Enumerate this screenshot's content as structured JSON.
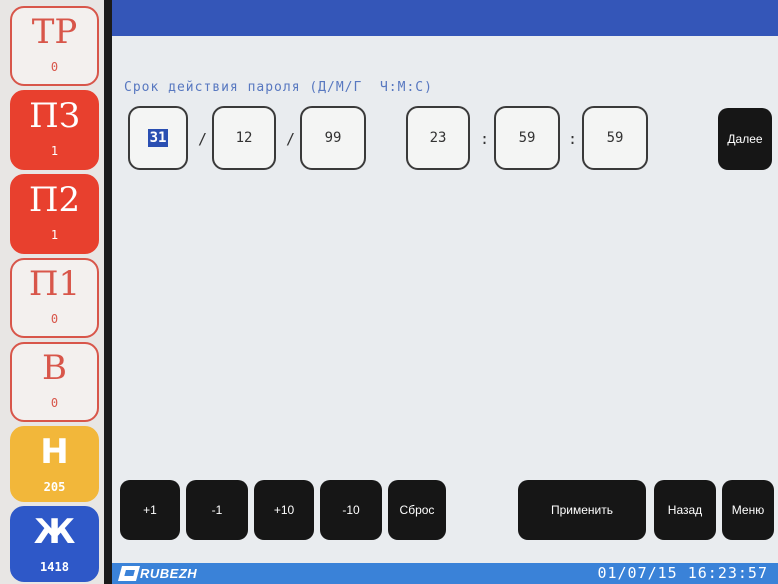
{
  "sidebar": {
    "indicators": [
      {
        "label": "ТР",
        "count": "0",
        "state": "off"
      },
      {
        "label": "ПЗ",
        "count": "1",
        "state": "red"
      },
      {
        "label": "П2",
        "count": "1",
        "state": "red"
      },
      {
        "label": "П1",
        "count": "0",
        "state": "off"
      },
      {
        "label": "В",
        "count": "0",
        "state": "off"
      },
      {
        "label": "Н",
        "count": "205",
        "state": "yellow"
      },
      {
        "label": "Ж",
        "count": "1418",
        "state": "blue"
      }
    ]
  },
  "form": {
    "title": "Срок действия пароля (Д/М/Г  Ч:М:С)",
    "day": "31",
    "month": "12",
    "year": "99",
    "hour": "23",
    "minute": "59",
    "second": "59",
    "date_sep": "/",
    "time_sep": ":"
  },
  "buttons": {
    "next": "Далее",
    "plus1": "+1",
    "minus1": "-1",
    "plus10": "+10",
    "minus10": "-10",
    "reset": "Сброс",
    "apply": "Применить",
    "back": "Назад",
    "menu": "Меню"
  },
  "statusbar": {
    "brand": "RUBEZH",
    "datetime": "01/07/15 16:23:57"
  },
  "colors": {
    "accent": "#2a4fb2",
    "topbar": "#3456b8",
    "statusbar": "#3a82d8",
    "alarm_red": "#e8402e",
    "warning_yellow": "#f2b73a"
  }
}
